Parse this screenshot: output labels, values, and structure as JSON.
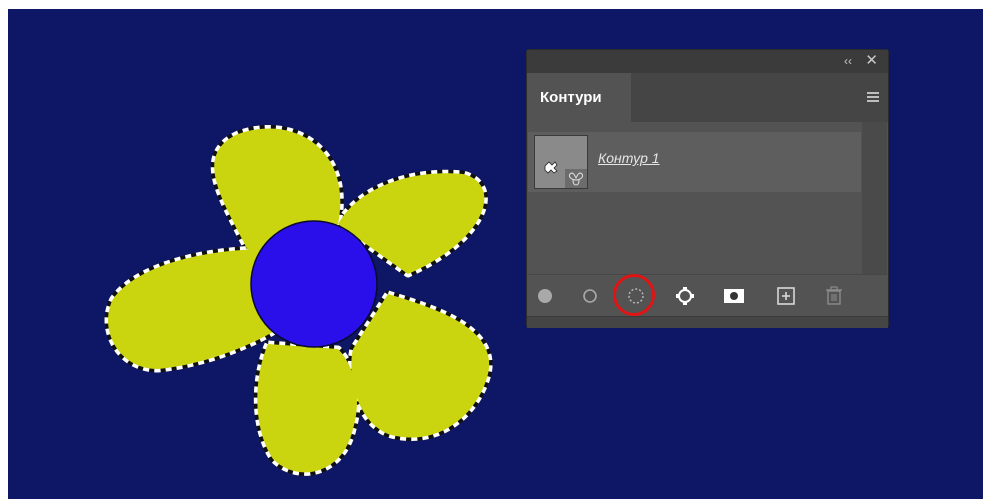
{
  "colors": {
    "canvas_background": "#0d1766",
    "petal_fill": "#cad510",
    "center_fill": "#2a0fea",
    "highlight_ring": "#e01414"
  },
  "panel": {
    "collapse_icon": "double-chevron-left-icon",
    "close_icon": "close-icon",
    "tab_label": "Контури",
    "menu_icon": "hamburger-menu-icon",
    "paths": [
      {
        "label": "Контур 1"
      }
    ],
    "toolbar": [
      {
        "name": "fill-path-icon"
      },
      {
        "name": "stroke-path-icon"
      },
      {
        "name": "load-path-as-selection-icon",
        "highlighted": true
      },
      {
        "name": "make-work-path-icon"
      },
      {
        "name": "add-mask-icon"
      },
      {
        "name": "create-new-path-icon"
      },
      {
        "name": "delete-path-icon"
      }
    ]
  }
}
